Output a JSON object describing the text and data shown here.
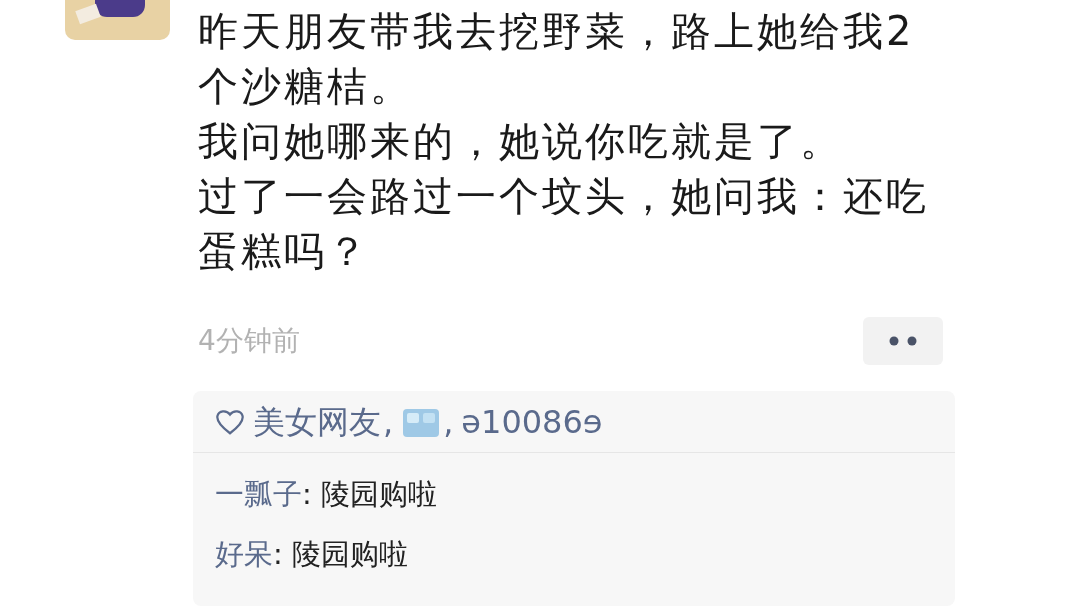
{
  "post": {
    "paragraphs": [
      "昨天朋友带我去挖野菜，路上她给我2个沙糖桔。",
      "我问她哪来的，她说你吃就是了。",
      "过了一会路过一个坟头，她问我：还吃蛋糕吗？"
    ],
    "time": "4分钟前"
  },
  "likes": {
    "names": [
      {
        "kind": "text",
        "text": "美女网友"
      },
      {
        "kind": "emoji"
      },
      {
        "kind": "text",
        "text": "ə10086ɘ"
      }
    ],
    "separator": ","
  },
  "comment_separator": ":",
  "comments": [
    {
      "author": "一瓢子",
      "text": "陵园购啦"
    },
    {
      "author": "好呆",
      "text": "陵园购啦"
    }
  ]
}
